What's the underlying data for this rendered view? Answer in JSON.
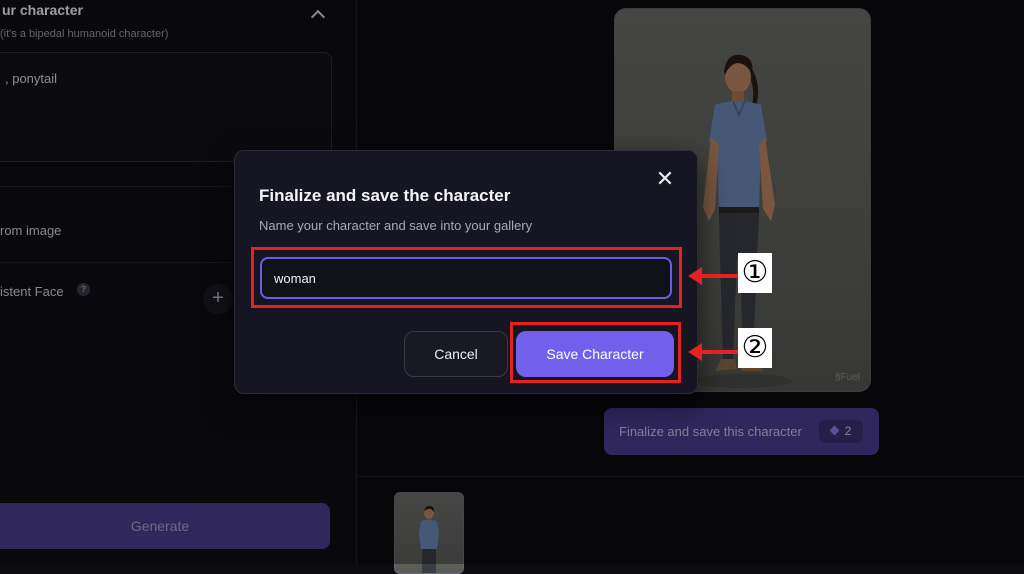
{
  "left_panel": {
    "section_title": "ur character",
    "section_subtitle": "(it's a bipedal humanoid character)",
    "description_text": ", ponytail",
    "row_from_image": "rom image",
    "row_consistent_face": "istent Face",
    "help_icon_glyph": "?",
    "add_button_glyph": "+",
    "generate_label": "Generate"
  },
  "right_panel": {
    "preview_watermark": "§Fuel",
    "finalize_label": "Finalize and save this character",
    "credit_cost": "2"
  },
  "modal": {
    "title": "Finalize and save the character",
    "subtitle": "Name your character and save into your gallery",
    "name_value": "woman",
    "close_glyph": "✕",
    "cancel_label": "Cancel",
    "save_label": "Save Character"
  },
  "annotations": {
    "marker_1": "①",
    "marker_2": "②",
    "color": "#e52222"
  },
  "colors": {
    "accent": "#7260ec",
    "accent_dim": "#4a3d8f",
    "background": "#0b0b10",
    "modal_bg": "#161622"
  }
}
